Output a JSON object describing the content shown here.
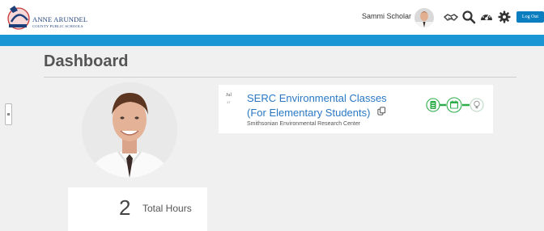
{
  "logo": {
    "line1": "ANNE ARUNDEL",
    "line2": "COUNTY PUBLIC SCHOOLS"
  },
  "topbar": {
    "user_name": "Sammi Scholar",
    "icons": [
      "handshake-icon",
      "search-icon",
      "dashboard-gauge-icon",
      "gear-icon"
    ],
    "logout_label": "Log Out"
  },
  "colors": {
    "accent": "#1b96d4",
    "logout": "#0b7ec0",
    "link": "#2a78c4",
    "progress_green": "#2eae4a"
  },
  "dashboard": {
    "title": "Dashboard",
    "hours": {
      "value": "2",
      "label": "Total Hours"
    },
    "class_card": {
      "month": "Jul",
      "day": "17",
      "title": "SERC Environmental Classes (For Elementary Students)",
      "organization": "Smithsonian Environmental Research Center",
      "progress_steps": [
        {
          "name": "document-icon",
          "state": "complete"
        },
        {
          "name": "calendar-icon",
          "state": "complete"
        },
        {
          "name": "lightbulb-icon",
          "state": "pending"
        }
      ]
    }
  }
}
